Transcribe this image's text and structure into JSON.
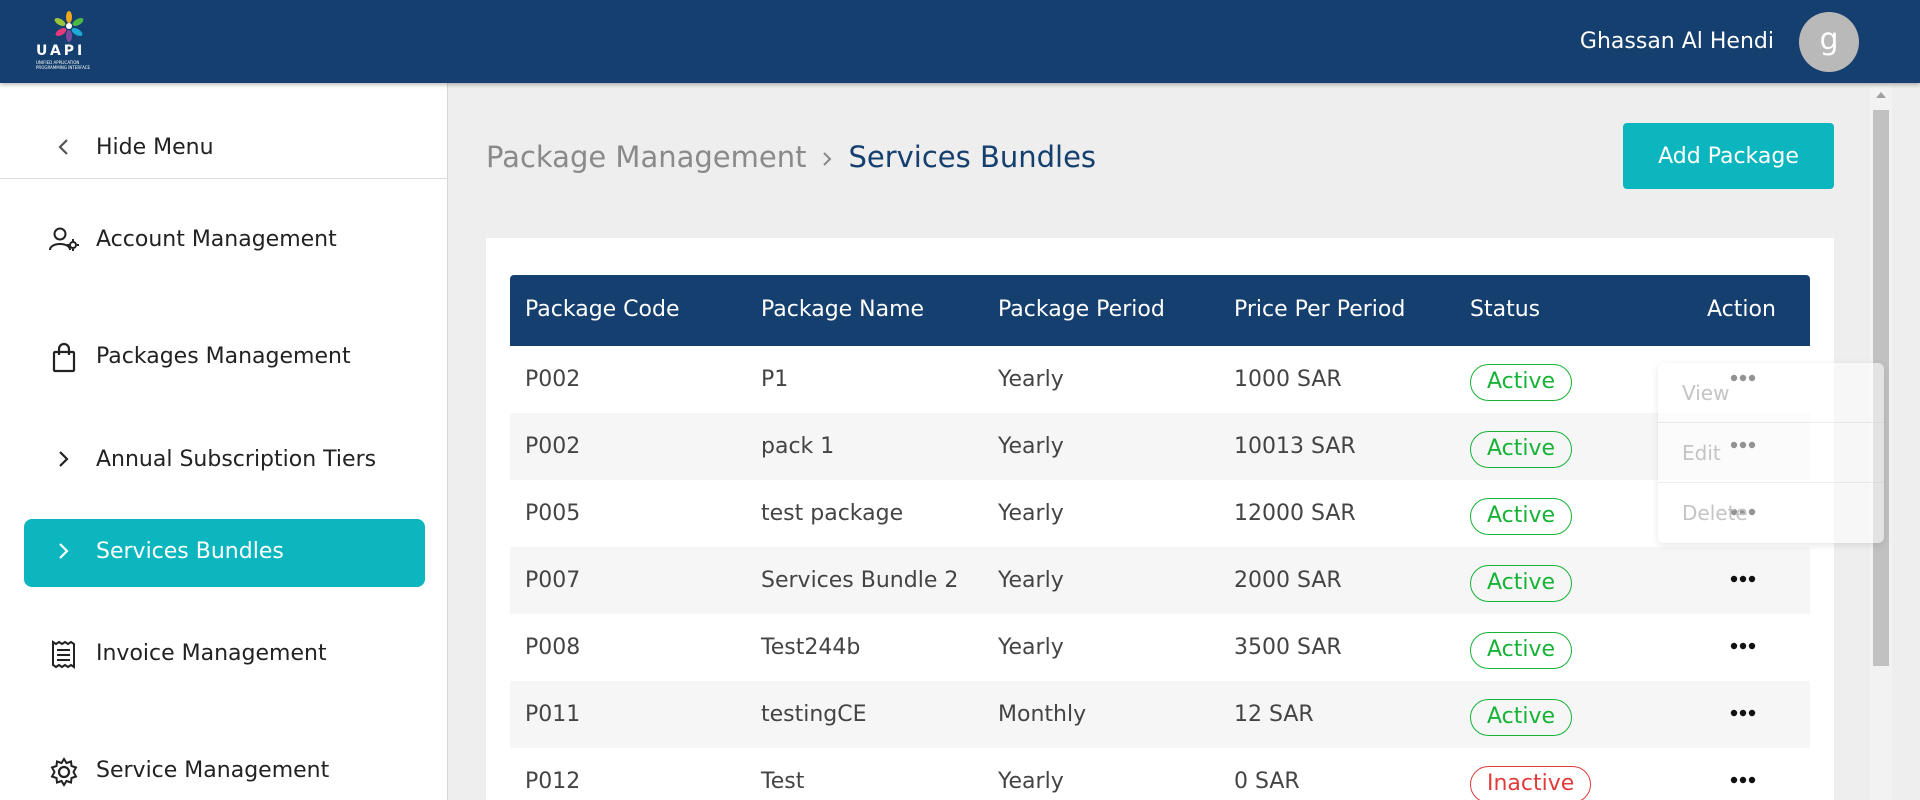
{
  "header": {
    "logo_text": "UAPI",
    "logo_tagline": "UNIFIED APPLICATION PROGRAMMING INTERFACE",
    "user_name": "Ghassan Al Hendi",
    "avatar_initial": "g"
  },
  "sidebar": {
    "hide_menu_label": "Hide Menu",
    "items": [
      {
        "label": "Account Management",
        "icon": "user-gear-icon"
      },
      {
        "label": "Packages Management",
        "icon": "shopping-bag-icon"
      },
      {
        "label": "Annual Subscription Tiers",
        "icon": "chevron-right-icon"
      },
      {
        "label": "Services Bundles",
        "icon": "chevron-right-icon",
        "active": true
      },
      {
        "label": "Invoice Management",
        "icon": "receipt-icon"
      },
      {
        "label": "Service Management",
        "icon": "gear-icon"
      }
    ]
  },
  "breadcrumb": {
    "parent": "Package Management",
    "current": "Services Bundles"
  },
  "actions": {
    "add_package": "Add Package"
  },
  "table": {
    "columns": [
      "Package Code",
      "Package Name",
      "Package Period",
      "Price Per Period",
      "Status",
      "Action"
    ],
    "rows": [
      {
        "code": "P002",
        "name": "P1",
        "period": "Yearly",
        "price": "1000 SAR",
        "status": "Active"
      },
      {
        "code": "P002",
        "name": "pack 1",
        "period": "Yearly",
        "price": "10013 SAR",
        "status": "Active"
      },
      {
        "code": "P005",
        "name": "test package",
        "period": "Yearly",
        "price": "12000 SAR",
        "status": "Active"
      },
      {
        "code": "P007",
        "name": "Services Bundle 2",
        "period": "Yearly",
        "price": "2000 SAR",
        "status": "Active"
      },
      {
        "code": "P008",
        "name": "Test244b",
        "period": "Yearly",
        "price": "3500 SAR",
        "status": "Active"
      },
      {
        "code": "P011",
        "name": "testingCE",
        "period": "Monthly",
        "price": "12 SAR",
        "status": "Active"
      },
      {
        "code": "P012",
        "name": "Test",
        "period": "Yearly",
        "price": "0 SAR",
        "status": "Inactive"
      }
    ]
  },
  "action_menu": {
    "items": [
      "View",
      "Edit",
      "Delete"
    ]
  },
  "colors": {
    "header_bg": "#143f6e",
    "accent": "#0cb6be",
    "status_active": "#16b336",
    "status_inactive": "#e23b3b"
  }
}
